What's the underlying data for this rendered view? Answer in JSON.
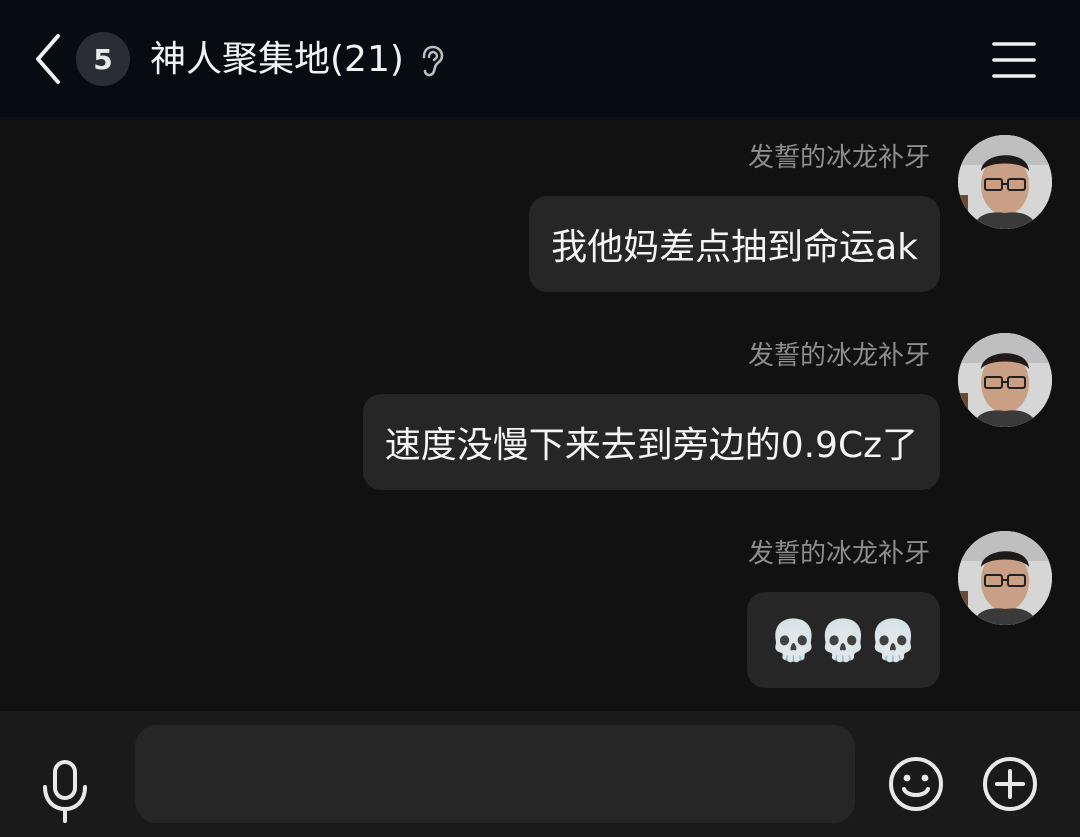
{
  "header": {
    "unread_count": "5",
    "title": "神人聚集地(21)",
    "icons": {
      "back": "chevron-left-icon",
      "earpiece": "ear-icon",
      "menu": "hamburger-menu-icon"
    }
  },
  "messages": [
    {
      "sender": "发誓的冰龙补牙",
      "text": "我他妈差点抽到命运ak"
    },
    {
      "sender": "发誓的冰龙补牙",
      "text": "速度没慢下来去到旁边的0.9Cz了"
    },
    {
      "sender": "发誓的冰龙补牙",
      "text": "💀💀💀"
    }
  ],
  "composer": {
    "value": "",
    "placeholder": "",
    "icons": {
      "voice": "microphone-icon",
      "emoji": "smiley-icon",
      "more": "plus-circle-icon"
    }
  },
  "colors": {
    "header_bg": "#070b12",
    "chat_bg": "#111111",
    "bubble_bg": "#262626",
    "bottom_bar_bg": "#1a1a1a"
  }
}
